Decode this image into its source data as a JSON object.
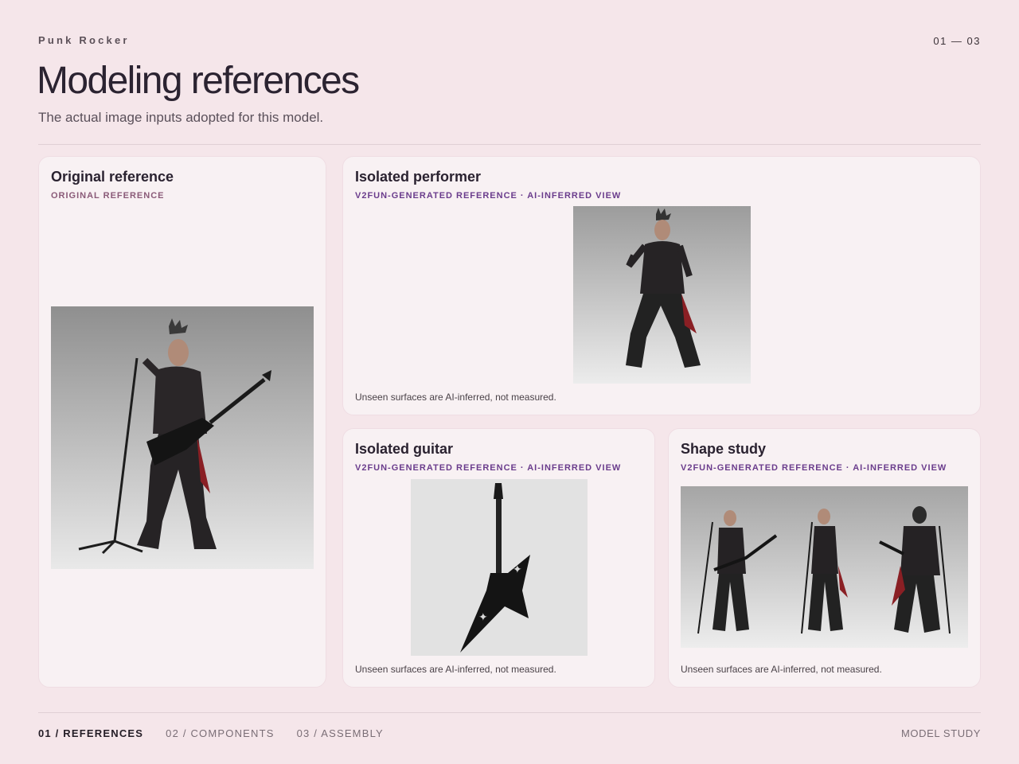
{
  "header": {
    "eyebrow": "Punk Rocker",
    "pager": "01 — 03",
    "title": "Modeling references",
    "subtitle": "The actual image inputs adopted for this model."
  },
  "cards": {
    "original": {
      "title": "Original reference",
      "tag": "ORIGINAL REFERENCE",
      "image": "punk-rocker-original-photo"
    },
    "performer": {
      "title": "Isolated performer",
      "tag": "V2FUN-GENERATED REFERENCE · AI-INFERRED VIEW",
      "note": "Unseen surfaces are AI-inferred, not measured.",
      "image": "isolated-performer-render"
    },
    "guitar": {
      "title": "Isolated guitar",
      "tag": "V2FUN-GENERATED REFERENCE · AI-INFERRED VIEW",
      "note": "Unseen surfaces are AI-inferred, not measured.",
      "image": "isolated-guitar-render"
    },
    "shape": {
      "title": "Shape study",
      "tag": "V2FUN-GENERATED REFERENCE · AI-INFERRED VIEW",
      "note": "Unseen surfaces are AI-inferred, not measured.",
      "image": "shape-study-turnaround"
    }
  },
  "nav": {
    "items": [
      {
        "label": "01 / REFERENCES",
        "active": true
      },
      {
        "label": "02 / COMPONENTS",
        "active": false
      },
      {
        "label": "03 / ASSEMBLY",
        "active": false
      }
    ],
    "right": "MODEL STUDY"
  },
  "colors": {
    "page_bg": "#f5e6ea",
    "card_bg": "#f8f1f3",
    "tag_original": "#8a5a78",
    "tag_generated": "#6a3c8c"
  }
}
